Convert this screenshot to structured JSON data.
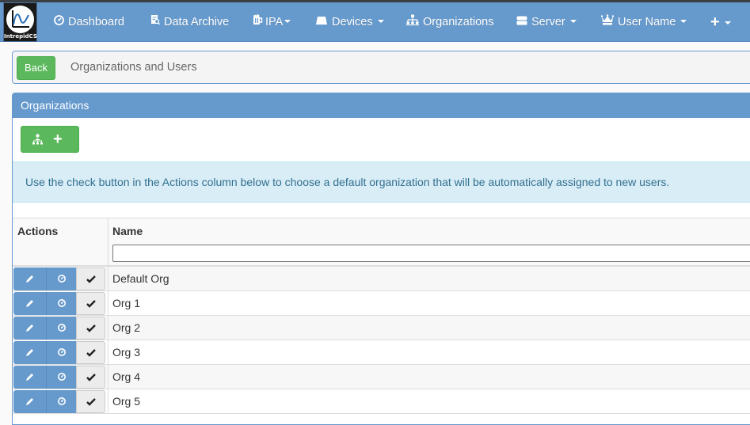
{
  "navbar": {
    "brand": "IntrepidCS",
    "items": [
      {
        "label": "Dashboard",
        "icon": "dashboard-icon",
        "dropdown": false
      },
      {
        "label": "Data Archive",
        "icon": "archive-search-icon",
        "dropdown": false
      },
      {
        "label": "IPA",
        "icon": "beer-mug-icon",
        "dropdown": true
      },
      {
        "label": "Devices",
        "icon": "device-icon",
        "dropdown": true
      },
      {
        "label": "Organizations",
        "icon": "sitemap-icon",
        "dropdown": false
      },
      {
        "label": "Server",
        "icon": "server-icon",
        "dropdown": true
      },
      {
        "label": "User Name",
        "icon": "crown-icon",
        "dropdown": true
      },
      {
        "label": "+",
        "icon": "plus-icon",
        "dropdown": true
      }
    ]
  },
  "breadcrumb": {
    "back_label": "Back",
    "title": "Organizations and Users"
  },
  "panel": {
    "title": "Organizations",
    "add_button_icon": "sitemap-plus-icon",
    "info_text": "Use the check button in the Actions column below to choose a default organization that will be automatically assigned to new users.",
    "table": {
      "columns": [
        "Actions",
        "Name"
      ],
      "filter_value": "",
      "rows": [
        {
          "name": "Default Org"
        },
        {
          "name": "Org 1"
        },
        {
          "name": "Org 2"
        },
        {
          "name": "Org 3"
        },
        {
          "name": "Org 4"
        },
        {
          "name": "Org 5"
        }
      ]
    }
  },
  "colors": {
    "navbar": "#6699cc",
    "success": "#5cb85c",
    "info_bg": "#d9edf7",
    "info_text": "#31708f"
  }
}
